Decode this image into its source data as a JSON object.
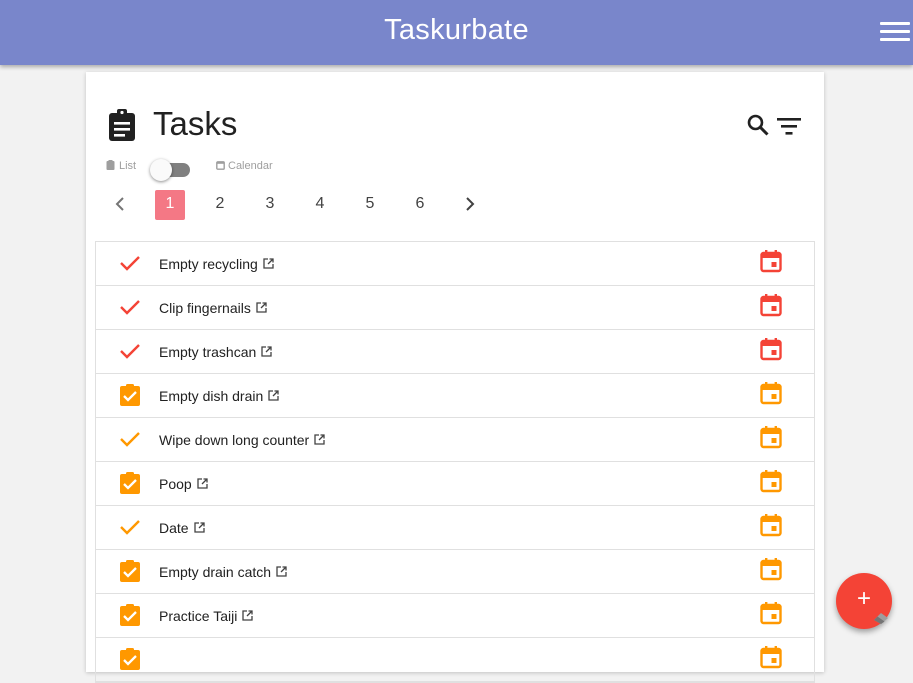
{
  "app": {
    "title": "Taskurbate"
  },
  "header": {
    "title": "Tasks"
  },
  "view_toggle": {
    "list_label": "List",
    "calendar_label": "Calendar",
    "calendar_view_on": false
  },
  "pagination": {
    "pages": [
      "1",
      "2",
      "3",
      "4",
      "5",
      "6"
    ],
    "current": "1"
  },
  "colors": {
    "appbar": "#7986cb",
    "overdue": "#f44336",
    "due": "#ff9800",
    "page_active": "#f47885",
    "fab": "#f44336"
  },
  "tasks": [
    {
      "name": "Empty recycling",
      "status_icon": "check-icon",
      "color": "#f44336"
    },
    {
      "name": "Clip fingernails",
      "status_icon": "check-icon",
      "color": "#f44336"
    },
    {
      "name": "Empty trashcan",
      "status_icon": "check-icon",
      "color": "#f44336"
    },
    {
      "name": "Empty dish drain",
      "status_icon": "clipboard-check-icon",
      "color": "#ff9800"
    },
    {
      "name": "Wipe down long counter",
      "status_icon": "check-icon",
      "color": "#ff9800"
    },
    {
      "name": "Poop",
      "status_icon": "clipboard-check-icon",
      "color": "#ff9800"
    },
    {
      "name": "Date",
      "status_icon": "check-icon",
      "color": "#ff9800"
    },
    {
      "name": "Empty drain catch",
      "status_icon": "clipboard-check-icon",
      "color": "#ff9800"
    },
    {
      "name": "Practice Taiji",
      "status_icon": "clipboard-check-icon",
      "color": "#ff9800"
    },
    {
      "name": "",
      "status_icon": "clipboard-check-icon",
      "color": "#ff9800"
    }
  ],
  "fab": {
    "label": "+"
  }
}
